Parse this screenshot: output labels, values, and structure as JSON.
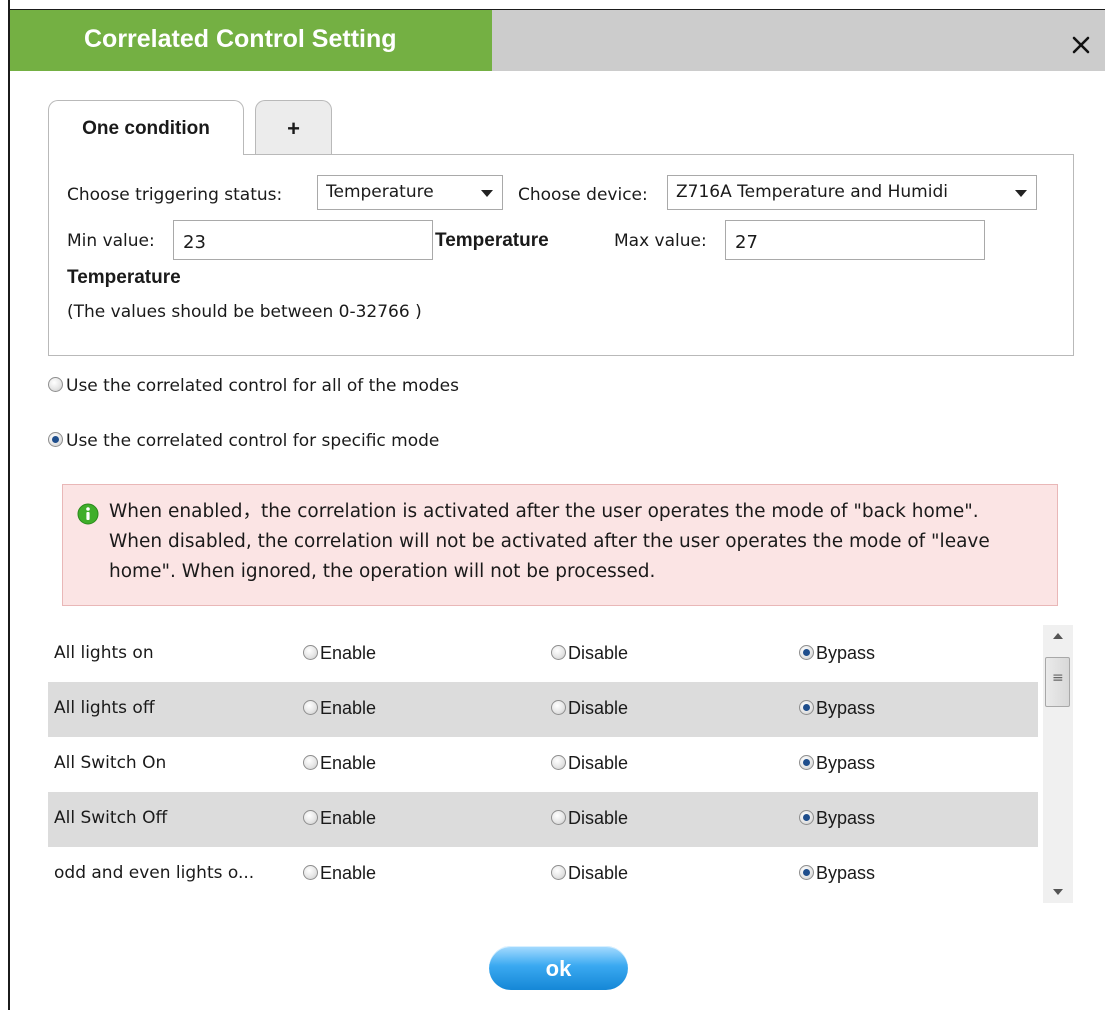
{
  "dialog": {
    "title": "Correlated Control Setting",
    "close_icon": "close-icon"
  },
  "colors": {
    "title_green": "#74b043",
    "title_gray": "#cccccc",
    "notice_bg": "#fbe4e4",
    "row_alt_bg": "#dcdcdc",
    "ok_blue": "#3aa9f1"
  },
  "tabs": [
    {
      "label": "One condition",
      "active": true
    },
    {
      "label": "+",
      "active": false
    }
  ],
  "condition": {
    "trigger_label": "Choose triggering status:",
    "trigger_value": "Temperature",
    "device_label": "Choose device:",
    "device_value": "Z716A Temperature and Humidi",
    "min_label": "Min value:",
    "min_value": "23",
    "min_unit": "Temperature",
    "max_label": "Max value:",
    "max_value": "27",
    "max_unit": "Temperature",
    "range_note": "(The values should be between 0-32766 )"
  },
  "scope": {
    "all_modes_label": "Use the correlated control for all of the modes",
    "specific_mode_label": "Use the correlated control for specific mode",
    "selected": "specific"
  },
  "notice": {
    "icon": "info-icon",
    "text": "When enabled，the correlation is activated after the user operates the mode of \"back home\". When disabled, the correlation will not be activated after the user operates the mode of \"leave home\". When ignored, the operation will not be processed."
  },
  "mode_options": [
    "Enable",
    "Disable",
    "Bypass"
  ],
  "modes": [
    {
      "name": "All lights on",
      "selected": "Bypass"
    },
    {
      "name": "All lights off",
      "selected": "Bypass"
    },
    {
      "name": "All Switch On",
      "selected": "Bypass"
    },
    {
      "name": "All Switch Off",
      "selected": "Bypass"
    },
    {
      "name": "odd and even lights o...",
      "selected": "Bypass"
    }
  ],
  "ok_label": "ok"
}
